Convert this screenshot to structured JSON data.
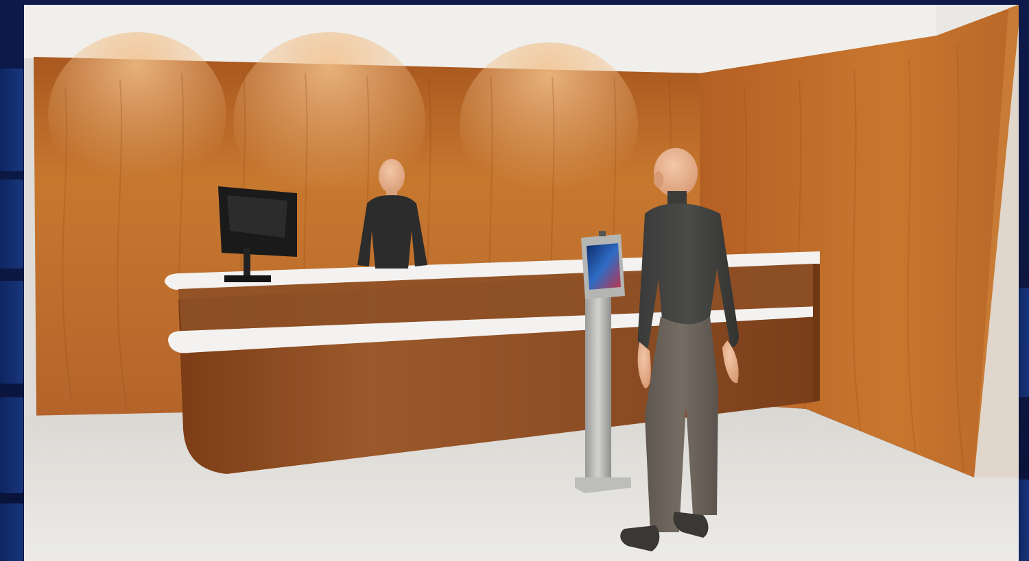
{
  "image": {
    "subject": "reception-desk-render",
    "colors": {
      "frame": "#0c1740",
      "ceiling": "#ecebe8",
      "wood_light": "#c9782e",
      "wood_dark": "#8a4316",
      "desk_wood": "#93542a",
      "countertop": "#f1f0ee",
      "floor": "#e6e4e0",
      "skin": "#e8b593",
      "clothing_dark": "#2b2b2b",
      "pants": "#6a625a",
      "kiosk_steel": "#b8b8b6",
      "kiosk_screen": "#1d4f9e"
    },
    "icons": [
      "monitor-icon",
      "kiosk-screen-icon"
    ]
  }
}
